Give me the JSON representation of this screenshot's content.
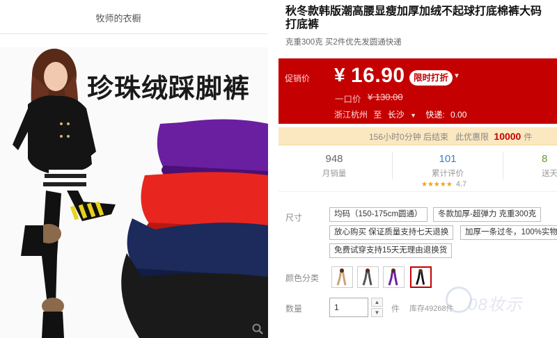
{
  "shop": {
    "name": "牧师的衣橱"
  },
  "gallery": {
    "slogan": "珍珠绒踩脚裤"
  },
  "product": {
    "title_line1": "秋冬款韩版潮高腰显瘦加厚加绒不起球打底棉裤大码",
    "title_line2": "打底裤",
    "subtitle": "克重300克 买2件优先发圆通快递"
  },
  "price_panel": {
    "label": "促销价",
    "currency": "¥",
    "price": "16.90",
    "promo_badge": "限时打折",
    "orig_label": "一口价",
    "orig_price": "¥ 130.00",
    "ship_from": "浙江杭州",
    "ship_to_label": "至",
    "ship_to": "长沙",
    "shipping_label": "快递:",
    "shipping_fee": "0.00"
  },
  "countdown": {
    "text": "156小时0分钟 后结束",
    "limit_label": "此优惠限",
    "limit_count": "10000",
    "limit_unit": "件"
  },
  "stats": {
    "monthly_sales": {
      "value": "948",
      "label": "月销量"
    },
    "reviews": {
      "value": "101",
      "label": "累计评价"
    },
    "gifts": {
      "value": "8",
      "label": "送天猫"
    },
    "rating": {
      "stars": "★★★★★",
      "score": "4.7"
    }
  },
  "sku": {
    "size_label": "尺寸",
    "size_options": [
      "均码（150-175cm圆通）",
      "冬款加厚-超弹力 克重300克",
      "放心购买 保证质量支持七天退换",
      "加厚一条过冬，100%实物",
      "免费试穿支持15天无理由退换货"
    ],
    "color_label": "颜色分类",
    "quantity_label": "数量",
    "quantity_value": "1",
    "unit": "件",
    "stock": "库存49268件"
  },
  "watermark": "08妆示",
  "colors": {
    "accent": "#c40000",
    "countdown_bg": "#fbe8c0",
    "leggings": [
      "#6a1fa0",
      "#e8261f",
      "#1c2a5c",
      "#1a1a1a"
    ]
  }
}
